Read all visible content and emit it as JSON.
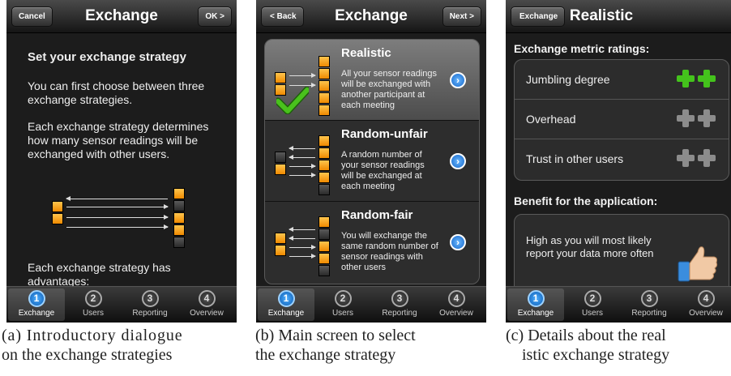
{
  "tabbar": {
    "items": [
      {
        "num": "1",
        "label": "Exchange"
      },
      {
        "num": "2",
        "label": "Users"
      },
      {
        "num": "3",
        "label": "Reporting"
      },
      {
        "num": "4",
        "label": "Overview"
      }
    ]
  },
  "screen1": {
    "nav": {
      "left": "Cancel",
      "title": "Exchange",
      "right": "OK >"
    },
    "heading": "Set your exchange strategy",
    "para1": "You can first choose between three exchange strategies.",
    "para2": "Each exchange strategy determines how many sensor readings will be exchanged with other users.",
    "para3": "Each exchange strategy has advantages:",
    "caption_line1": "(a) Introductory dialogue",
    "caption_line2": "on the exchange strategies"
  },
  "screen2": {
    "nav": {
      "left": "< Back",
      "title": "Exchange",
      "right": "Next >"
    },
    "strategies": [
      {
        "title": "Realistic",
        "desc": "All your sensor readings will be exchanged with another participant at each meeting"
      },
      {
        "title": "Random-unfair",
        "desc": "A random number of your sensor readings will be exchanged at each meeting"
      },
      {
        "title": "Random-fair",
        "desc": "You will exchange the same random number of sensor readings with other users"
      }
    ],
    "caption_line1": "(b) Main screen to select",
    "caption_line2": "the exchange strategy"
  },
  "screen3": {
    "nav": {
      "left": "Exchange",
      "title": "Realistic"
    },
    "metrics_heading": "Exchange metric ratings:",
    "metrics": [
      {
        "label": "Jumbling degree",
        "rating": 2
      },
      {
        "label": "Overhead",
        "rating": 0
      },
      {
        "label": "Trust in other users",
        "rating": 0
      }
    ],
    "benefit_heading": "Benefit for the application:",
    "benefit_text": "High as you will most likely report your data more often",
    "caption_line1": "(c) Details about the real",
    "caption_line2": "istic exchange strategy"
  },
  "colors": {
    "accent_blue": "#1566c9",
    "orange": "#ef8a00",
    "green_plus": "#44c31c",
    "gray_plus": "#9a9a9a"
  },
  "icons": {
    "selected_check": "green-check-icon",
    "disclosure": "chevron-right-icon",
    "thumbs_up": "thumbs-up-icon"
  }
}
